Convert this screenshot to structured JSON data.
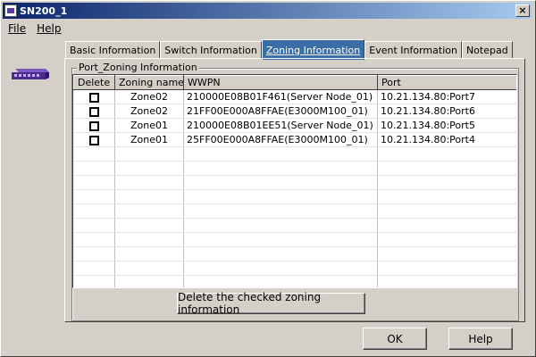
{
  "window": {
    "title": "SN200_1",
    "close_symbol": "×"
  },
  "menu": {
    "file": "File",
    "help": "Help"
  },
  "tabs": [
    {
      "label": "Basic Information",
      "active": false
    },
    {
      "label": "Switch Information",
      "active": false
    },
    {
      "label": "Zoning Information",
      "active": true
    },
    {
      "label": "Event Information",
      "active": false
    },
    {
      "label": "Notepad",
      "active": false
    }
  ],
  "group": {
    "label": "Port_Zoning Information"
  },
  "table": {
    "headers": [
      "Delete",
      "Zoning name",
      "WWPN",
      "Port"
    ],
    "rows": [
      {
        "checked": false,
        "zone": "Zone02",
        "wwpn": "210000E08B01F461(Server Node_01)",
        "port": "10.21.134.80:Port7"
      },
      {
        "checked": false,
        "zone": "Zone02",
        "wwpn": "21FF00E000A8FFAE(E3000M100_01)",
        "port": "10.21.134.80:Port6"
      },
      {
        "checked": false,
        "zone": "Zone01",
        "wwpn": "210000E08B01EE51(Server Node_01)",
        "port": "10.21.134.80:Port5"
      },
      {
        "checked": false,
        "zone": "Zone01",
        "wwpn": "25FF00E000A8FFAE(E3000M100_01)",
        "port": "10.21.134.80:Port4"
      }
    ]
  },
  "buttons": {
    "delete_checked": "Delete the checked zoning information",
    "ok": "OK",
    "help": "Help"
  },
  "colors": {
    "title_start": "#0a246a",
    "title_end": "#a6caf0",
    "active_tab": "#3a6ea5",
    "device": "#5a3a9a"
  },
  "icons": {
    "app": "app-icon",
    "device": "switch-device-icon",
    "close": "close-icon"
  }
}
